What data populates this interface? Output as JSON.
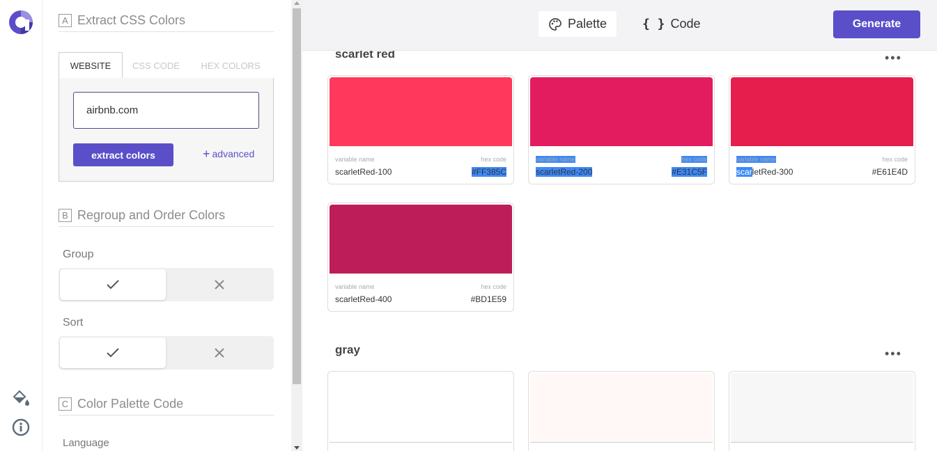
{
  "sidebar": {
    "section_a": {
      "letter": "A",
      "title": "Extract CSS Colors"
    },
    "tabs": [
      {
        "label": "WEBSITE",
        "active": true
      },
      {
        "label": "CSS CODE",
        "active": false
      },
      {
        "label": "HEX COLORS",
        "active": false
      }
    ],
    "url_value": "airbnb.com",
    "extract_label": "extract colors",
    "advanced_label": "advanced",
    "section_b": {
      "letter": "B",
      "title": "Regroup and Order Colors"
    },
    "group_label": "Group",
    "sort_label": "Sort",
    "section_c": {
      "letter": "C",
      "title": "Color Palette Code"
    },
    "language_label": "Language"
  },
  "topbar": {
    "palette_label": "Palette",
    "code_label": "Code",
    "generate_label": "Generate"
  },
  "groups": [
    {
      "title": "scarlet red",
      "cards": [
        {
          "color": "#FF385C",
          "var_label": "variable name",
          "hex_label": "hex code",
          "name": "scarletRed-100",
          "hex": "#FF385C"
        },
        {
          "color": "#E31C5F",
          "var_label": "variable name",
          "hex_label": "hex code",
          "name": "scarletRed-200",
          "hex": "#E31C5F"
        },
        {
          "color": "#E61E4D",
          "var_label": "variable name",
          "hex_label": "hex code",
          "name_sel": "scar",
          "name_rest": "letRed-300",
          "hex": "#E61E4D"
        },
        {
          "color": "#BD1E59",
          "var_label": "variable name",
          "hex_label": "hex code",
          "name": "scarletRed-400",
          "hex": "#BD1E59"
        }
      ]
    },
    {
      "title": "gray",
      "cards": [
        {
          "color": "#FFFFFF"
        },
        {
          "color": "#FFF8F6"
        },
        {
          "color": "#F7F7F7"
        }
      ]
    }
  ],
  "colors": {
    "accent": "#5A4FC8",
    "selection": "#3D8AF7"
  }
}
